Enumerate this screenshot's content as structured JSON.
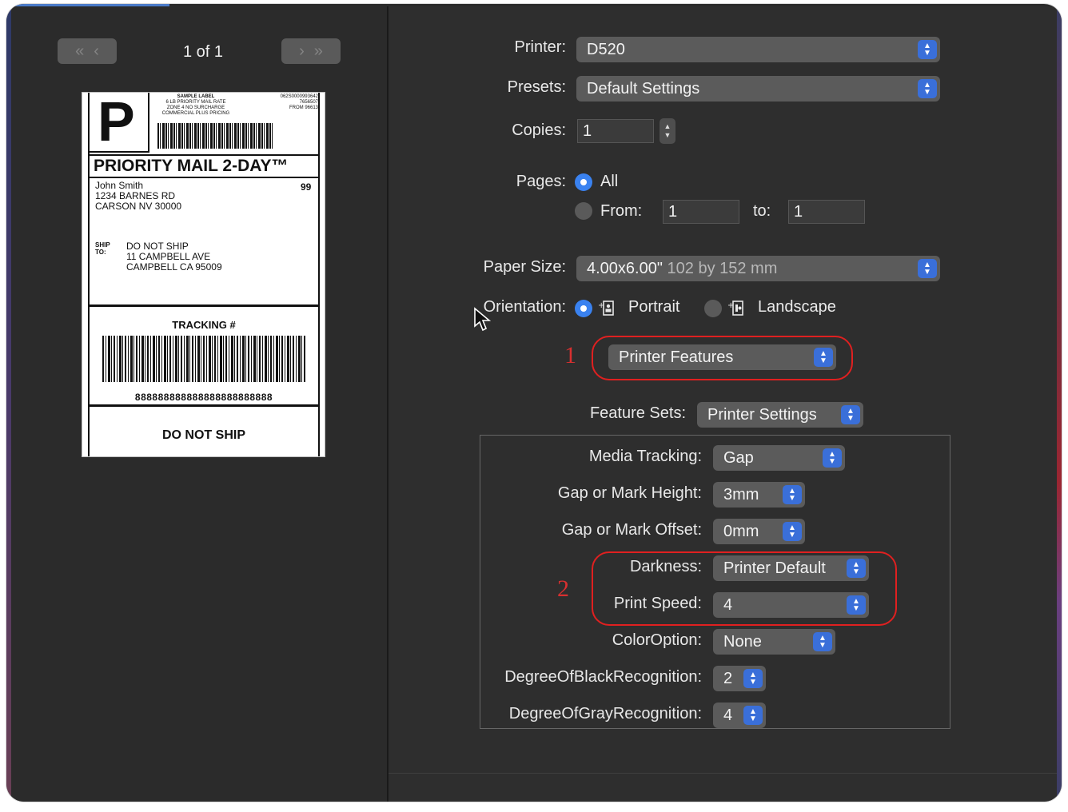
{
  "preview": {
    "page_counter": "1 of 1",
    "label": {
      "big_letter": "P",
      "header_lines": [
        "SAMPLE LABEL",
        "6 LB PRIORITY MAIL RATE",
        "ZONE 4 NO SURCHARGE",
        "COMMERCIAL PLUS PRICING"
      ],
      "header_right_lines": [
        "062S0000993642",
        "7656507",
        "FROM 96613"
      ],
      "service_title": "PRIORITY MAIL 2-DAY™",
      "from_address": "John Smith\n1234 BARNES RD\nCARSON NV 30000",
      "from_number": "99",
      "ship_to_label": "SHIP\nTO:",
      "ship_to_address": "DO NOT SHIP\n11 CAMPBELL AVE\nCAMPBELL CA 95009",
      "tracking_title": "TRACKING #",
      "tracking_number": "888888888888888888888888",
      "footer": "DO NOT SHIP"
    }
  },
  "print": {
    "printer_label": "Printer:",
    "printer_value": "D520",
    "presets_label": "Presets:",
    "presets_value": "Default Settings",
    "copies_label": "Copies:",
    "copies_value": "1",
    "pages_label": "Pages:",
    "pages_all": "All",
    "pages_from": "From:",
    "pages_from_value": "1",
    "pages_to": "to:",
    "pages_to_value": "1",
    "paper_size_label": "Paper Size:",
    "paper_size_value": "4.00x6.00\"",
    "paper_size_detail": "102 by 152 mm",
    "orientation_label": "Orientation:",
    "orientation_portrait": "Portrait",
    "orientation_landscape": "Landscape",
    "section_popup": "Printer Features",
    "feature_sets_label": "Feature Sets:",
    "feature_sets_value": "Printer Settings"
  },
  "features": [
    {
      "label": "Media Tracking:",
      "value": "Gap"
    },
    {
      "label": "Gap or Mark Height:",
      "value": "3mm"
    },
    {
      "label": "Gap or Mark Offset:",
      "value": "0mm"
    },
    {
      "label": "Darkness:",
      "value": "Printer Default"
    },
    {
      "label": "Print Speed:",
      "value": "4"
    },
    {
      "label": "ColorOption:",
      "value": "None"
    },
    {
      "label": "DegreeOfBlackRecognition:",
      "value": "2"
    },
    {
      "label": "DegreeOfGrayRecognition:",
      "value": "4"
    }
  ],
  "annotations": {
    "one": "1",
    "two": "2",
    "color": "#e02020"
  },
  "icons": {
    "nav_first": "«",
    "nav_prev": "‹",
    "nav_next": "›",
    "nav_last": "»",
    "popup_chevron_up": "▲",
    "popup_chevron_down": "▼"
  }
}
